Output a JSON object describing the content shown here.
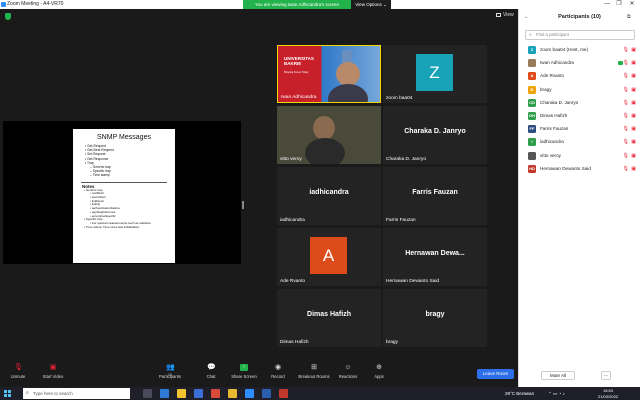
{
  "window": {
    "title": "Zoom Meeting - A4-VR70",
    "viewing_banner": "You are viewing Iwan Adhicandra's screen",
    "view_options": "View Options ⌄",
    "controls": [
      "—",
      "❐",
      "✕"
    ]
  },
  "meeting": {
    "view_label": "View"
  },
  "slide": {
    "title": "SNMP Messages",
    "bullets": [
      "Get-Request",
      "Get-Next-Request",
      "Set-Request",
      "Get-Response",
      "Trap"
    ],
    "trap_sub": [
      "Generic trap",
      "Specific trap",
      "Time stamp"
    ],
    "notes_title": "Notes",
    "notes": [
      "Generic trap",
      "coldStart",
      "warmStart",
      "linkDown",
      "linkUp",
      "authenticationFailure",
      "egpNeighborLoss",
      "enterpriseSpecific",
      "Specific trap",
      "For special measurements such as statistics",
      "Time stamp: Time since last initialization"
    ]
  },
  "gallery": [
    {
      "name": "Iwan Adhicandra",
      "kind": "video-banner",
      "banner_line1": "UNIVERSITAS",
      "banner_line2": "BAKRIE",
      "banner_tag": "Shaping Future Today"
    },
    {
      "name": "zoom baa04",
      "kind": "avatar",
      "letter": "Z",
      "color": "#17a2b8"
    },
    {
      "name": "vitto veroy",
      "kind": "video-face"
    },
    {
      "name": "Charaka D. Janryo",
      "kind": "text",
      "big": "Charaka D. Janryo"
    },
    {
      "name": "iadhicandra",
      "kind": "text",
      "big": "iadhicandra"
    },
    {
      "name": "Farris Fauzan",
      "kind": "text",
      "big": "Farris Fauzan"
    },
    {
      "name": "Ade Rvanto",
      "kind": "avatar",
      "letter": "A",
      "color": "#dd4b1a"
    },
    {
      "name": "Hernawan Dewanto Said",
      "kind": "text",
      "big": "Hernawan  Dewa..."
    },
    {
      "name": "Dimas Hafizh",
      "kind": "text",
      "big": "Dimas Hafizh"
    },
    {
      "name": "bragy",
      "kind": "text",
      "big": "bragy"
    }
  ],
  "toolbar": {
    "unmute": "Unmute",
    "start_video": "Start Video",
    "participants": "Participants",
    "participants_count": "10",
    "chat": "Chat",
    "share_screen": "Share Screen",
    "record": "Record",
    "breakout": "Breakout Rooms",
    "reactions": "Reactions",
    "apps": "Apps",
    "leave": "Leave Room"
  },
  "panel": {
    "title": "Participants (10)",
    "search_placeholder": "Find a participant",
    "participants": [
      {
        "initials": "Z",
        "name": "zoom baa04 (Host, me)",
        "color": "#17a2b8",
        "video_on": false
      },
      {
        "initials": "",
        "name": "Iwan Adhicandra",
        "color": "#9a7b5c",
        "video_on": true
      },
      {
        "initials": "A",
        "name": "Ade Rvanto",
        "color": "#dd4b1a",
        "video_on": false
      },
      {
        "initials": "B",
        "name": "bragy",
        "color": "#f0a30a",
        "video_on": false
      },
      {
        "initials": "CD",
        "name": "Charaka D. Janryo",
        "color": "#2e9e4a",
        "video_on": false
      },
      {
        "initials": "DH",
        "name": "Dimas Hafizh",
        "color": "#2e9e4a",
        "video_on": false
      },
      {
        "initials": "FF",
        "name": "Farris Fauzan",
        "color": "#2b4c7e",
        "video_on": false
      },
      {
        "initials": "I",
        "name": "iadhicandra",
        "color": "#2e9e4a",
        "video_on": false
      },
      {
        "initials": "",
        "name": "vitto veroy",
        "color": "#555555",
        "video_on": false
      },
      {
        "initials": "HD",
        "name": "Hernawan Dewanto Said",
        "color": "#c0392b",
        "video_on": false
      }
    ],
    "mute_all": "Mute All",
    "more": "..."
  },
  "taskbar": {
    "search_placeholder": "Type here to search",
    "weather": "29°C  Berawan",
    "time": "18:53",
    "date": "21/03/2022"
  }
}
